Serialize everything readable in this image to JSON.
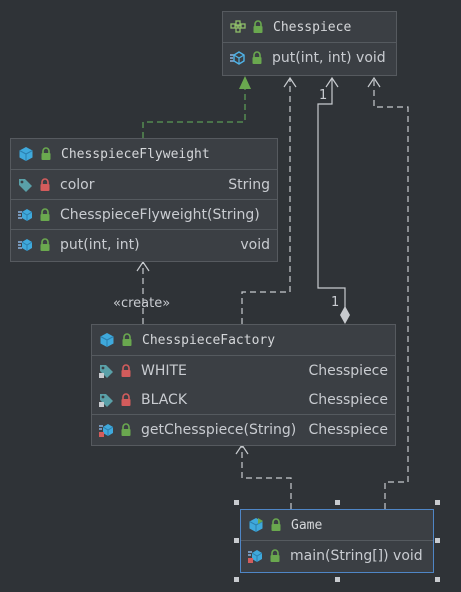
{
  "classes": {
    "chesspiece": {
      "name": "Chesspiece",
      "methods": [
        {
          "name": "put(int, int) void"
        }
      ]
    },
    "flyweight": {
      "name": "ChesspieceFlyweight",
      "fields": [
        {
          "name": "color",
          "type": "String"
        }
      ],
      "constructors": [
        {
          "name": "ChesspieceFlyweight(String)"
        }
      ],
      "methods": [
        {
          "name": "put(int, int)",
          "type": "void"
        }
      ]
    },
    "factory": {
      "name": "ChesspieceFactory",
      "fields": [
        {
          "name": "WHITE",
          "type": "Chesspiece"
        },
        {
          "name": "BLACK",
          "type": "Chesspiece"
        }
      ],
      "methods": [
        {
          "name": "getChesspiece(String)",
          "type": "Chesspiece"
        }
      ]
    },
    "game": {
      "name": "Game",
      "methods": [
        {
          "name": "main(String[]) void"
        }
      ]
    }
  },
  "labels": {
    "create": "«create»",
    "mult_top": "1",
    "mult_bottom": "1"
  },
  "colors": {
    "background": "#2f3337",
    "box": "#3b3f44",
    "dashed_line": "#c8cbcf",
    "realization_line": "#5b9a56",
    "realization_arrow": "#6aa84f",
    "selection": "#4f86c6",
    "class_icon": "#3fa9dc",
    "lock_public": "#6aa84f",
    "lock_private": "#d35c5c"
  },
  "icons": {
    "interface": "interface-icon",
    "class": "class-icon",
    "field": "field-icon",
    "method": "method-icon",
    "constructor": "constructor-icon",
    "static_field": "static-field-icon",
    "public": "public-lock-icon",
    "private": "private-lock-icon"
  }
}
